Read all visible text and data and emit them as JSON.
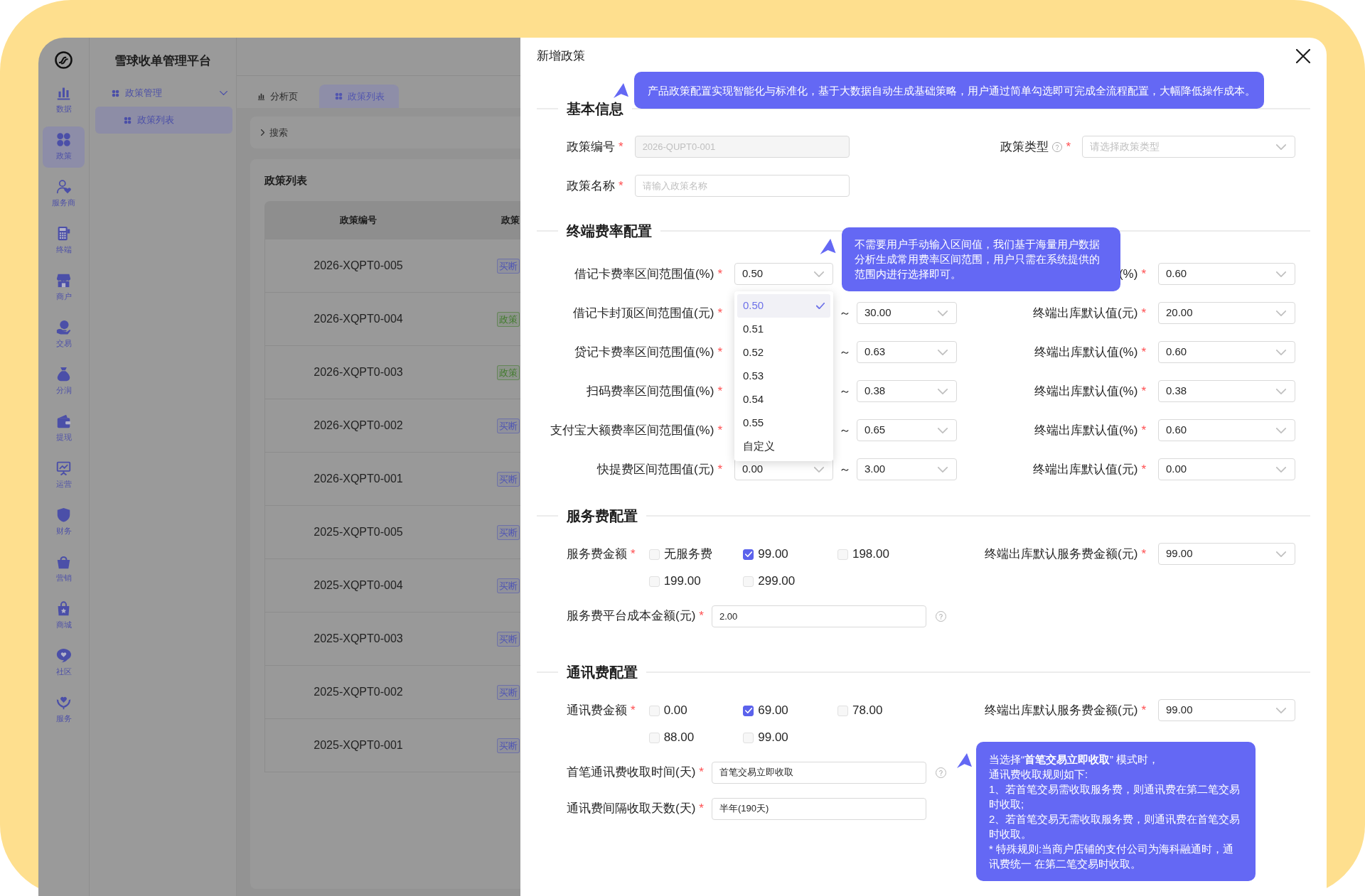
{
  "sidebar": {
    "items": [
      {
        "label": "数据",
        "selected": false
      },
      {
        "label": "政策",
        "selected": true
      },
      {
        "label": "服务商",
        "selected": false
      },
      {
        "label": "终端",
        "selected": false
      },
      {
        "label": "商户",
        "selected": false
      },
      {
        "label": "交易",
        "selected": false
      },
      {
        "label": "分润",
        "selected": false
      },
      {
        "label": "提现",
        "selected": false
      },
      {
        "label": "运营",
        "selected": false
      },
      {
        "label": "财务",
        "selected": false
      },
      {
        "label": "营销",
        "selected": false
      },
      {
        "label": "商城",
        "selected": false
      },
      {
        "label": "社区",
        "selected": false
      },
      {
        "label": "服务",
        "selected": false
      }
    ]
  },
  "menu": {
    "title": "雪球收单管理平台",
    "groups": [
      {
        "label": "政策管理",
        "expanded": true,
        "children": [
          {
            "label": "政策列表",
            "selected": true
          }
        ]
      }
    ]
  },
  "tabs": [
    {
      "label": "分析页",
      "selected": false
    },
    {
      "label": "政策列表",
      "selected": true
    }
  ],
  "search": {
    "label": "搜索",
    "expanded": false
  },
  "policy_list": {
    "title": "政策列表",
    "columns": [
      "政策编号",
      "政策"
    ],
    "rows": [
      {
        "policy_no": "2026-XQPT0-005",
        "type": {
          "text": "买断",
          "color": "#4f55b4"
        }
      },
      {
        "policy_no": "2026-XQPT0-004",
        "type": {
          "text": "政策",
          "color": "#3f7a2a"
        }
      },
      {
        "policy_no": "2026-XQPT0-003",
        "type": {
          "text": "政策",
          "color": "#3f7a2a"
        }
      },
      {
        "policy_no": "2026-XQPT0-002",
        "type": {
          "text": "买断",
          "color": "#4f55b4"
        }
      },
      {
        "policy_no": "2026-XQPT0-001",
        "type": {
          "text": "买断",
          "color": "#4f55b4"
        }
      },
      {
        "policy_no": "2025-XQPT0-005",
        "type": {
          "text": "买断",
          "color": "#4f55b4"
        }
      },
      {
        "policy_no": "2025-XQPT0-004",
        "type": {
          "text": "买断",
          "color": "#4f55b4"
        }
      },
      {
        "policy_no": "2025-XQPT0-003",
        "type": {
          "text": "买断",
          "color": "#4f55b4"
        }
      },
      {
        "policy_no": "2025-XQPT0-002",
        "type": {
          "text": "买断",
          "color": "#4f55b4"
        }
      },
      {
        "policy_no": "2025-XQPT0-001",
        "type": {
          "text": "买断",
          "color": "#4f55b4"
        }
      }
    ]
  },
  "drawer": {
    "title": "新增政策",
    "sections": [
      {
        "kind": "basic",
        "title": "基本信息",
        "rows": [
          {
            "fields": [
              {
                "kind": "input",
                "label": "政策编号",
                "required_mark": "*",
                "value": "2026-QUPT0-001",
                "disabled": true
              },
              {
                "kind": "select",
                "label": "政策类型",
                "help": true,
                "required_mark": "*",
                "placeholder": "请选择政策类型"
              }
            ]
          },
          {
            "fields": [
              {
                "kind": "input",
                "label": "政策名称",
                "required_mark": "*",
                "placeholder": "请输入政策名称"
              }
            ]
          }
        ]
      },
      {
        "kind": "rates",
        "title": "终端费率配置",
        "rows": [
          {
            "label": "借记卡费率区间范围值(%)",
            "required_mark": "*",
            "min": {
              "value": "0.50",
              "open": true,
              "options": [
                {
                  "label": "0.50",
                  "selected": true
                },
                {
                  "label": "0.51",
                  "selected": false
                },
                {
                  "label": "0.52",
                  "selected": false
                },
                {
                  "label": "0.53",
                  "selected": false
                },
                {
                  "label": "0.54",
                  "selected": false
                },
                {
                  "label": "0.55",
                  "selected": false
                },
                {
                  "label": "自定义",
                  "selected": false
                }
              ]
            },
            "default_label": "(%)",
            "default_required_mark": "*",
            "default": "0.60"
          },
          {
            "label": "借记卡封顶区间范围值(元)",
            "required_mark": "*",
            "separator": "～",
            "max": "30.00",
            "default_label": "终端出库默认值(元)",
            "default_required_mark": "*",
            "default": "20.00"
          },
          {
            "label": "贷记卡费率区间范围值(%)",
            "required_mark": "*",
            "separator": "～",
            "max": "0.63",
            "default_label": "终端出库默认值(%)",
            "default_required_mark": "*",
            "default": "0.60"
          },
          {
            "label": "扫码费率区间范围值(%)",
            "required_mark": "*",
            "separator": "～",
            "max": "0.38",
            "default_label": "终端出库默认值(%)",
            "default_required_mark": "*",
            "default": "0.38"
          },
          {
            "label": "支付宝大额费率区间范围值(%)",
            "required_mark": "*",
            "separator": "～",
            "max": "0.65",
            "default_label": "终端出库默认值(%)",
            "default_required_mark": "*",
            "default": "0.60"
          },
          {
            "label": "快提费区间范围值(元)",
            "required_mark": "*",
            "min": {
              "value": "0.00"
            },
            "separator": "～",
            "max": "3.00",
            "default_label": "终端出库默认值(元)",
            "default_required_mark": "*",
            "default": "0.00"
          }
        ]
      },
      {
        "kind": "fees",
        "title": "服务费配置",
        "amount": {
          "label": "服务费金额",
          "required_mark": "*",
          "options": [
            {
              "label": "无服务费",
              "checked": false
            },
            {
              "label": "99.00",
              "checked": true
            },
            {
              "label": "198.00",
              "checked": false
            },
            {
              "label": "199.00",
              "checked": false
            },
            {
              "label": "299.00",
              "checked": false
            }
          ]
        },
        "default": {
          "label": "终端出库默认服务费金额(元)",
          "required_mark": "*",
          "value": "99.00"
        },
        "fields": [
          {
            "label": "服务费平台成本金额(元)",
            "required_mark": "*",
            "value": "2.00",
            "help": true
          }
        ]
      },
      {
        "kind": "fees",
        "title": "通讯费配置",
        "amount": {
          "label": "通讯费金额",
          "required_mark": "*",
          "options": [
            {
              "label": "0.00",
              "checked": false
            },
            {
              "label": "69.00",
              "checked": true
            },
            {
              "label": "78.00",
              "checked": false
            },
            {
              "label": "88.00",
              "checked": false
            },
            {
              "label": "99.00",
              "checked": false
            }
          ]
        },
        "default": {
          "label": "终端出库默认服务费金额(元)",
          "required_mark": "*",
          "value": "99.00"
        },
        "fields": [
          {
            "label": "首笔通讯费收取时间(天)",
            "required_mark": "*",
            "value": "首笔交易立即收取",
            "help": true
          },
          {
            "label": "通讯费间隔收取天数(天)",
            "required_mark": "*",
            "value": "半年(190天)"
          }
        ]
      }
    ],
    "tooltips": [
      {
        "paragraphs": [
          "产品政策配置实现智能化与标准化，基于大数据自动生成基础策略，用户通过简单勾选即可完成全流程配置，大幅降低操作成本。"
        ]
      },
      {
        "paragraphs": [
          "不需要用户手动输入区间值，我们基于海量用户数据分析生成常用费率区间范围，用户只需在系统提供的范围内进行选择即可。"
        ]
      },
      {
        "paragraphs": [
          "当选择“**首笔交易立即收取**” 模式时，",
          "通讯费收取规则如下:",
          "1、若首笔交易需收取服务费，则通讯费在第二笔交易时收取;",
          "2、若首笔交易无需收取服务费，则通讯费在首笔交易时收取。",
          "* 特殊规则:当商户店铺的支付公司为海科融通时，通讯费统一 在第二笔交易时收取。"
        ]
      }
    ]
  }
}
